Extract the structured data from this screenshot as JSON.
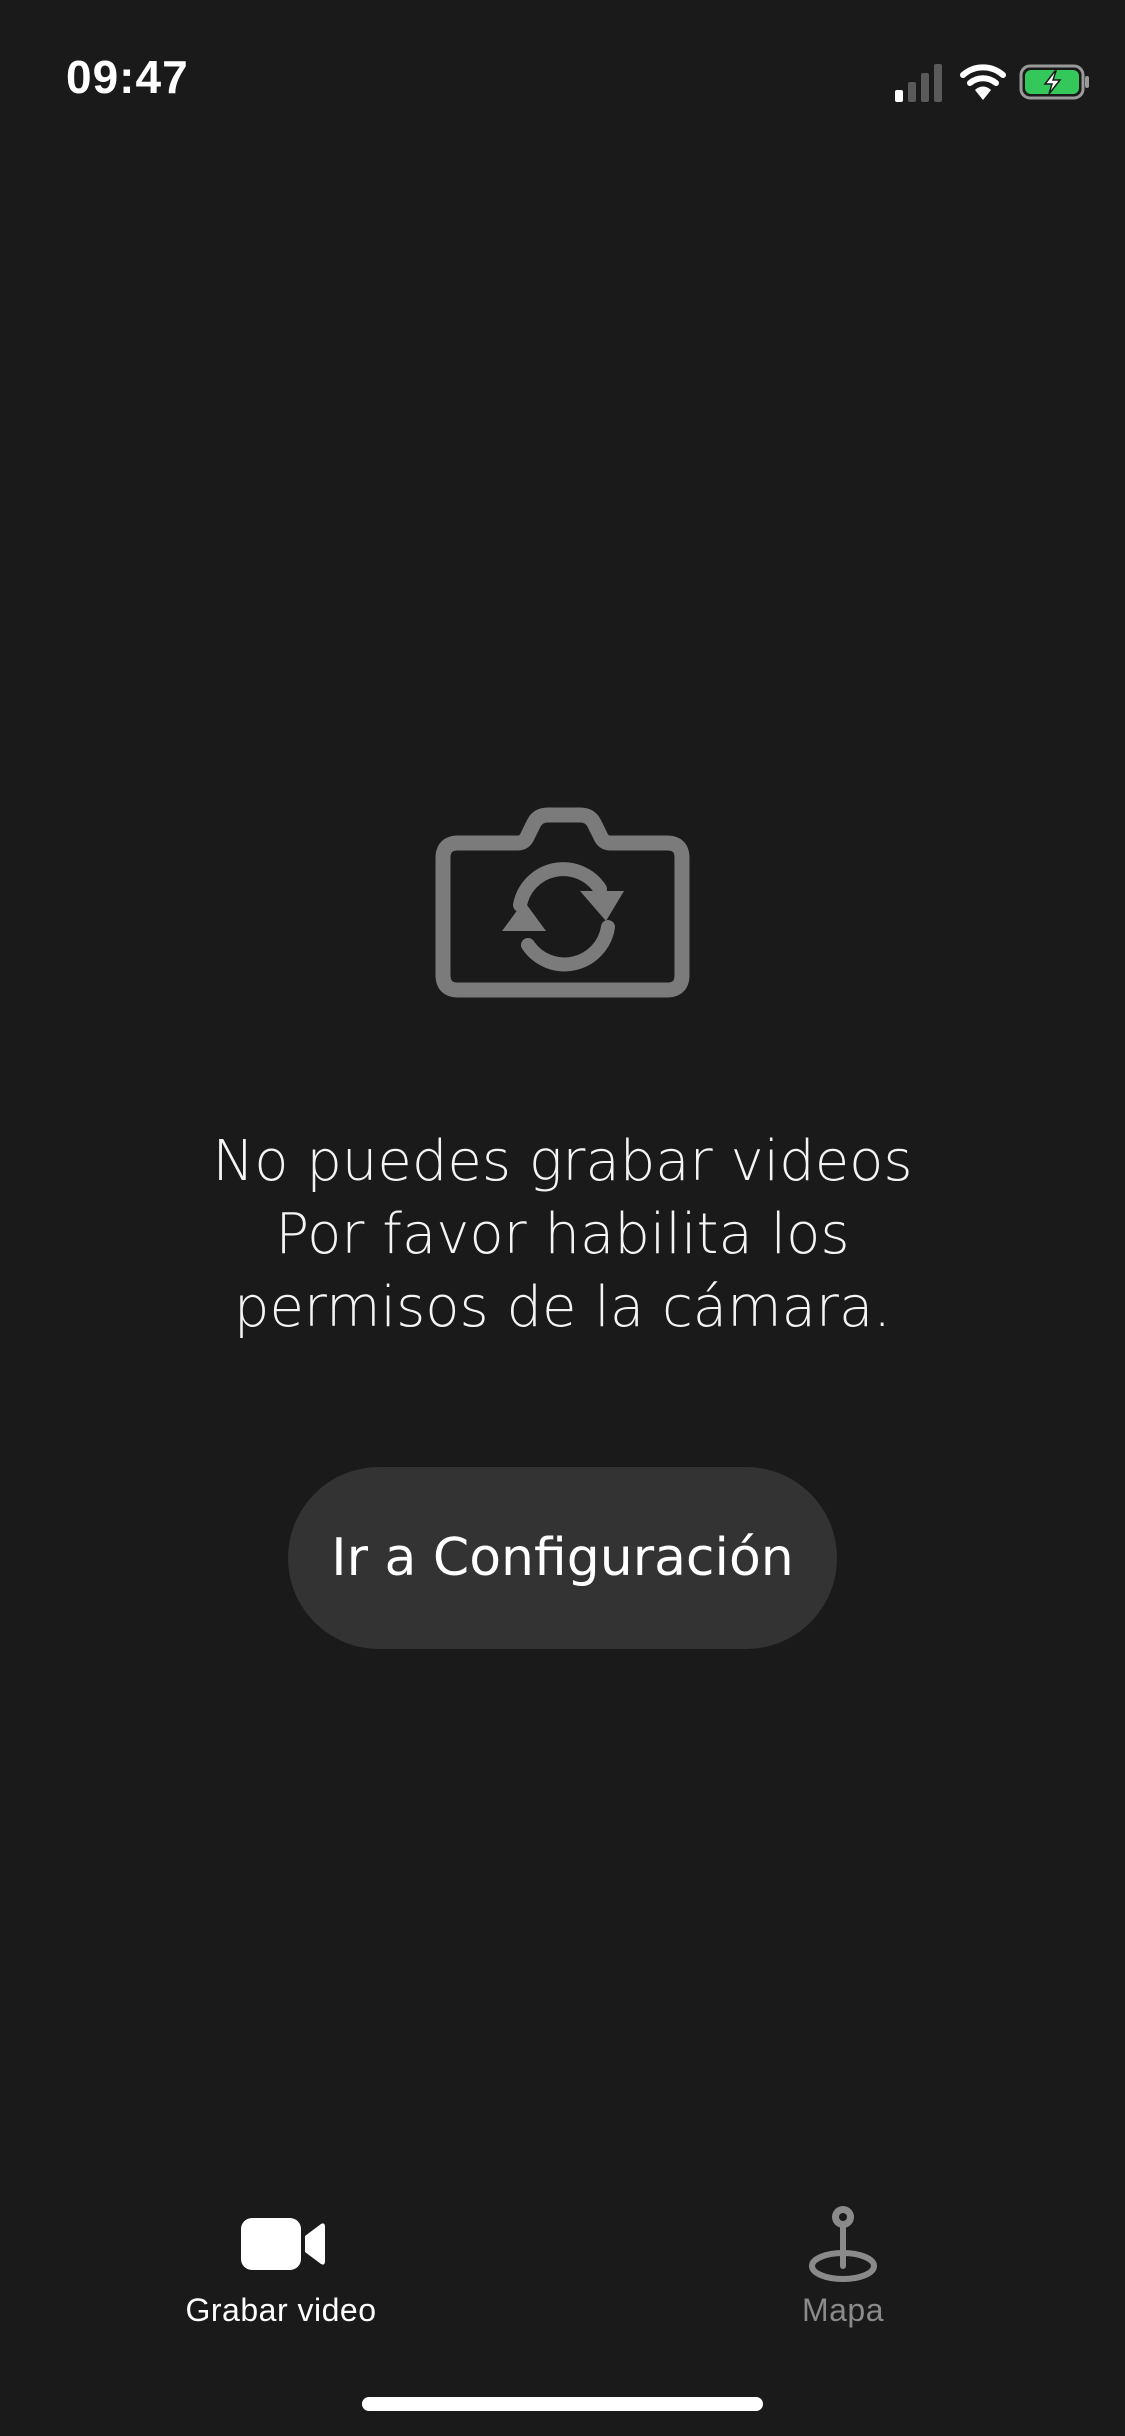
{
  "status_bar": {
    "time": "09:47",
    "battery_color": "#34c759"
  },
  "main": {
    "message_lines": [
      "No puedes grabar videos",
      "Por favor habilita los",
      "permisos de la cámara."
    ],
    "settings_button_label": "Ir a Configuración",
    "icon": "camera-switch-icon"
  },
  "tab_bar": {
    "items": [
      {
        "label": "Grabar video",
        "icon": "video-camera-icon",
        "active": true
      },
      {
        "label": "Mapa",
        "icon": "map-pin-icon",
        "active": false
      }
    ]
  },
  "colors": {
    "background": "#1a1a1a",
    "button_background": "#333333",
    "icon_gray": "#7b7b7b",
    "inactive_tab": "#8a8a8a"
  }
}
